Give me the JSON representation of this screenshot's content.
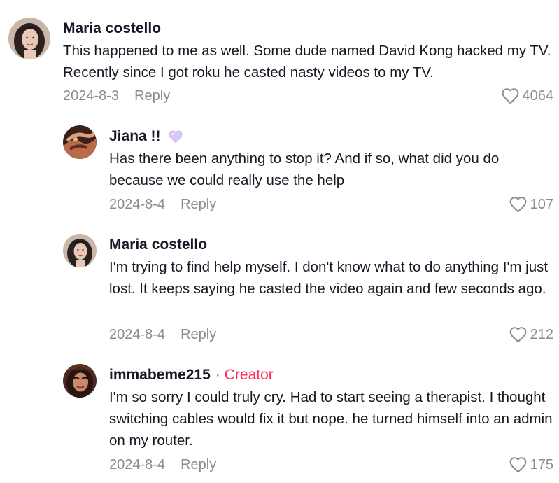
{
  "comments": [
    {
      "username": "Maria costello",
      "text": "This happened to me as well. Some dude named David Kong hacked my TV. Recently since I got roku he casted nasty videos to my TV.",
      "date": "2024-8-3",
      "reply_label": "Reply",
      "likes": "4064"
    },
    {
      "username": "Jiana !!",
      "emoji_icon": "purple-heart-icon",
      "text": "Has there been anything to stop it? And if so, what did you do because we could really use the help",
      "date": "2024-8-4",
      "reply_label": "Reply",
      "likes": "107"
    },
    {
      "username": "Maria costello",
      "text": "I'm trying to find help myself. I don't know what to do anything I'm just lost. It keeps saying he casted the video again and few seconds ago.",
      "date": "2024-8-4",
      "reply_label": "Reply",
      "likes": "212"
    },
    {
      "username": "immabeme215",
      "separator": "·",
      "badge": "Creator",
      "text": "I'm so sorry I could truly cry. Had to start seeing a therapist. I thought switching cables would fix it but nope. he turned himself into an admin on my router.",
      "date": "2024-8-4",
      "reply_label": "Reply",
      "likes": "175"
    }
  ],
  "colors": {
    "text": "#161823",
    "muted": "#8a8b91",
    "creator": "#fe2c55",
    "heart_emoji": "#d9c8f5"
  }
}
